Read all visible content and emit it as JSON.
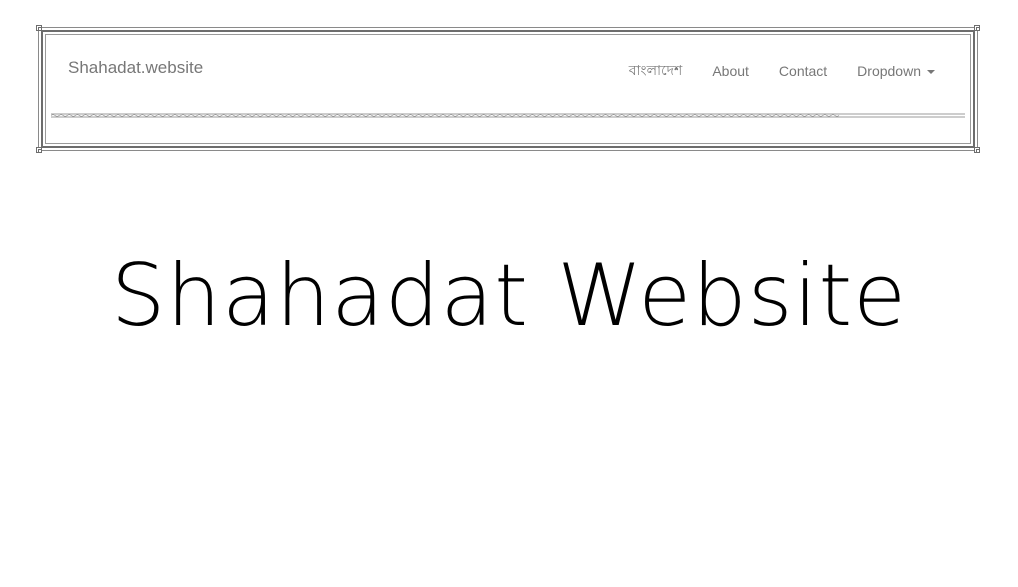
{
  "navbar": {
    "brand": "Shahadat.website",
    "items": [
      {
        "label": "বাংলাদেশ"
      },
      {
        "label": "About"
      },
      {
        "label": "Contact"
      },
      {
        "label": "Dropdown",
        "has_caret": true
      }
    ]
  },
  "hero": {
    "title": "Shahadat Website"
  },
  "colors": {
    "nav_text": "#777777",
    "frame": "#6d6d6d",
    "title": "#000000",
    "background": "#ffffff"
  }
}
